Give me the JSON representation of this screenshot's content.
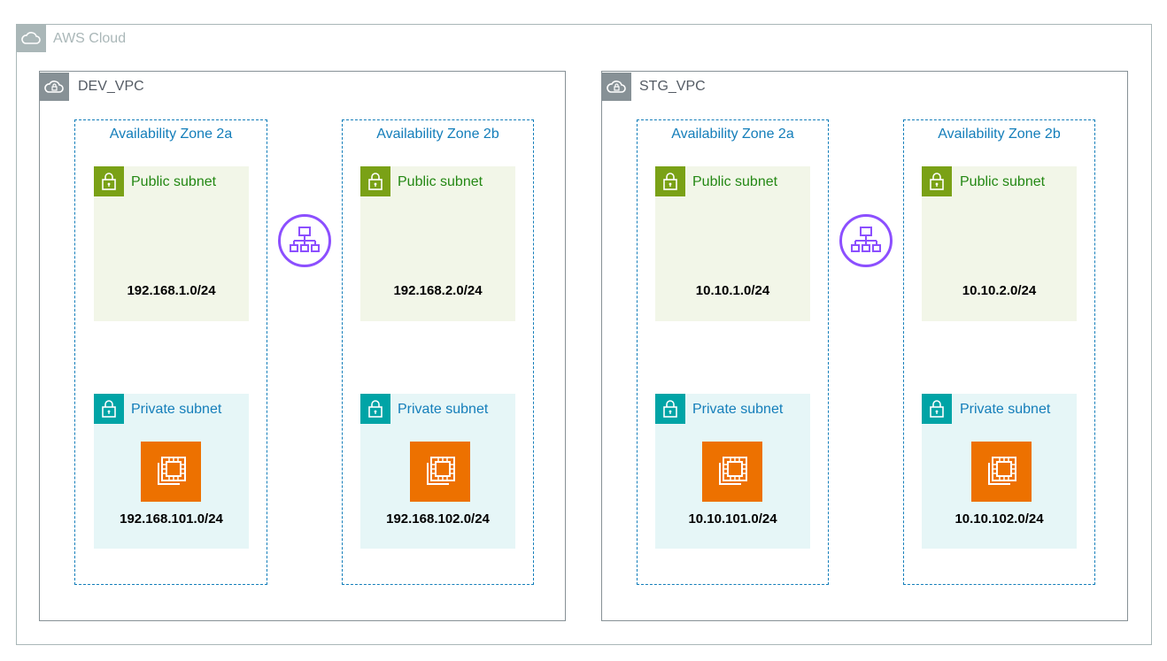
{
  "cloud": {
    "label": "AWS Cloud",
    "icon": "cloud-icon"
  },
  "vpcs": [
    {
      "label": "DEV_VPC",
      "azs": [
        {
          "label": "Availability Zone 2a",
          "public": {
            "title": "Public subnet",
            "cidr": "192.168.1.0/24"
          },
          "private": {
            "title": "Private subnet",
            "cidr": "192.168.101.0/24"
          }
        },
        {
          "label": "Availability Zone 2b",
          "public": {
            "title": "Public subnet",
            "cidr": "192.168.2.0/24"
          },
          "private": {
            "title": "Private subnet",
            "cidr": "192.168.102.0/24"
          }
        }
      ]
    },
    {
      "label": "STG_VPC",
      "azs": [
        {
          "label": "Availability Zone 2a",
          "public": {
            "title": "Public subnet",
            "cidr": "10.10.1.0/24"
          },
          "private": {
            "title": "Private subnet",
            "cidr": "10.10.101.0/24"
          }
        },
        {
          "label": "Availability Zone 2b",
          "public": {
            "title": "Public subnet",
            "cidr": "10.10.2.0/24"
          },
          "private": {
            "title": "Private subnet",
            "cidr": "10.10.102.0/24"
          }
        }
      ]
    }
  ],
  "colors": {
    "cloud_border": "#aab7b8",
    "vpc_border": "#879196",
    "az_border": "#147eba",
    "public_fill": "#f2f6e8",
    "public_accent": "#7aa116",
    "private_fill": "#e6f6f7",
    "private_accent": "#00a4a6",
    "ec2": "#ed7100",
    "load_balancer": "#8c4fff"
  },
  "icons": [
    "cloud-icon",
    "vpc-cloud-lock-icon",
    "padlock-icon",
    "ec2-instance-icon",
    "load-balancer-icon"
  ]
}
